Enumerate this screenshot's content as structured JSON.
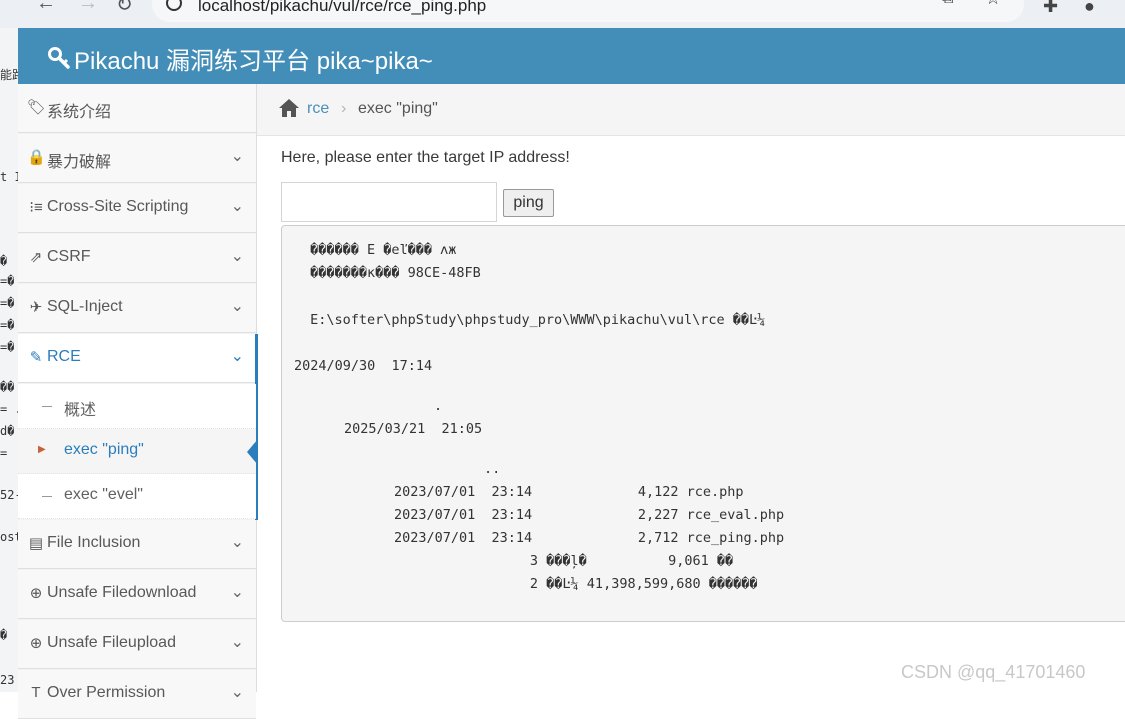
{
  "browser": {
    "url": "localhost/pikachu/vul/rce/rce_ping.php"
  },
  "background_window": {
    "fragments": [
      "能路",
      "t IP",
      "�",
      "=�",
      "=�",
      "=�",
      "=�",
      "��",
      "= .",
      "d�",
      "=",
      "52-",
      "ost",
      "�",
      "23"
    ]
  },
  "navbar": {
    "brand": "Pikachu 漏洞练习平台 pika~pika~",
    "brand_color": "#438eb9"
  },
  "sidebar": {
    "items": [
      {
        "label": "系统介绍",
        "icon": "tags-icon"
      },
      {
        "label": "暴力破解",
        "icon": "lock-icon"
      },
      {
        "label": "Cross-Site Scripting",
        "icon": "list-icon"
      },
      {
        "label": "CSRF",
        "icon": "share-icon"
      },
      {
        "label": "SQL-Inject",
        "icon": "plane-icon"
      },
      {
        "label": "RCE",
        "icon": "pencil-icon"
      },
      {
        "label": "File Inclusion",
        "icon": "file-icon"
      },
      {
        "label": "Unsafe Filedownload",
        "icon": "download-icon"
      },
      {
        "label": "Unsafe Fileupload",
        "icon": "upload-icon"
      },
      {
        "label": "Over Permission",
        "icon": "text-icon"
      }
    ],
    "rce_sub": [
      {
        "label": "概述"
      },
      {
        "label": "exec \"ping\""
      },
      {
        "label": "exec \"evel\""
      }
    ],
    "active_color": "#2b7dbc"
  },
  "breadcrumb": {
    "parent": "rce",
    "separator": "›",
    "current": "exec \"ping\""
  },
  "form": {
    "prompt": "Here, please enter the target IP address!",
    "input_value": "",
    "button_label": "ping"
  },
  "output": {
    "lines": [
      " ������ E �eľ��� ʌж",
      " �������к��� 98CE-48FB",
      "",
      " E:\\softer\\phpStudy\\phpstudy_pro\\WWW\\pikachu\\vul\\rce ��Ŀ¼",
      "",
      "2024/09/30  17:14    <DIR>          .",
      "2025/03/21  21:05    <DIR>          ..",
      "2023/07/01  23:14             4,122 rce.php",
      "2023/07/01  23:14             2,227 rce_eval.php",
      "2023/07/01  23:14             2,712 rce_ping.php",
      "               3 ���ļ�          9,061 ��",
      "               2 ��Ŀ¼ 41,398,599,680 ������"
    ],
    "dir_dot": ".",
    "dir_dotdot": "..",
    "date_dot": "2025/03/21  21:05",
    "date_root": "2024/09/30  17:14"
  },
  "watermark": "CSDN @qq_41701460"
}
